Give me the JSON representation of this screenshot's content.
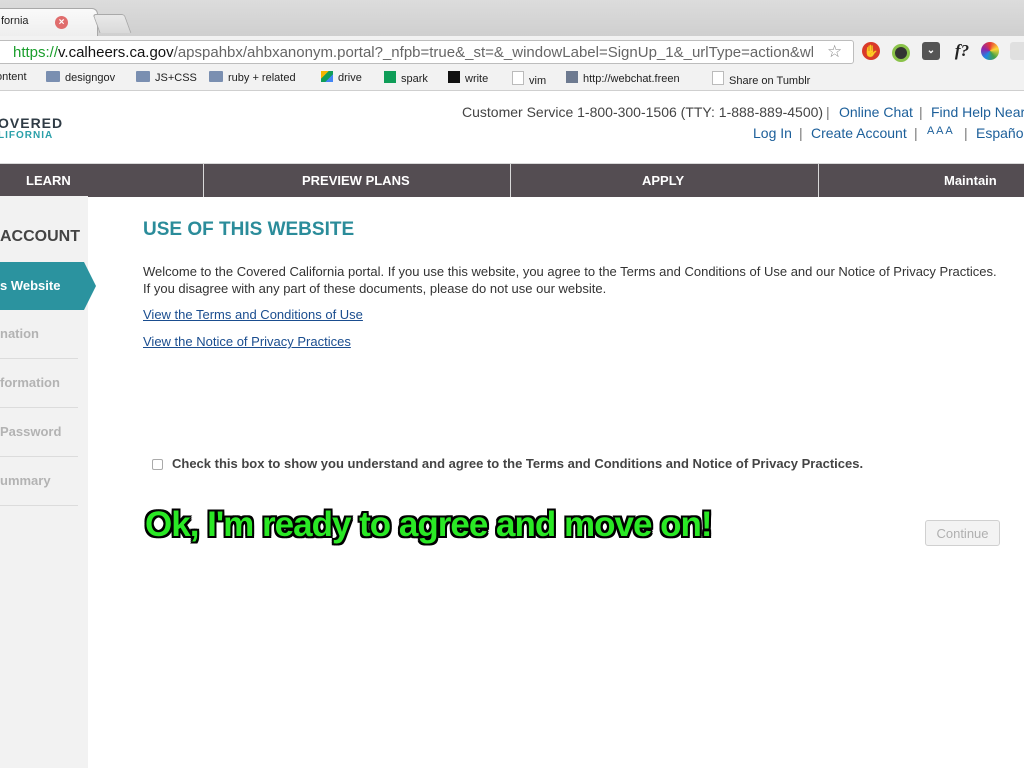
{
  "browser": {
    "tab_title": "fornia",
    "tab_close": "×",
    "url_scheme": "https://",
    "url_host": "v.calheers.ca.gov",
    "url_path": "/apspahbx/ahbxanonym.portal?_nfpb=true&_st=&_windowLabel=SignUp_1&_urlType=action&wl...",
    "star_icon": "☆",
    "extensions": [
      "hand-icon",
      "colorpicker-icon",
      "pocket-icon",
      "font-icon",
      "colorwheel-icon"
    ],
    "font_ext_label": "f?",
    "bookmarks": [
      {
        "label": "ontent",
        "icon": "folder-icon"
      },
      {
        "label": "designgov",
        "icon": "folder-icon"
      },
      {
        "label": "JS+CSS",
        "icon": "folder-icon"
      },
      {
        "label": "ruby + related",
        "icon": "folder-icon"
      },
      {
        "label": "drive",
        "icon": "drive-icon"
      },
      {
        "label": "spark",
        "icon": "sheet-icon"
      },
      {
        "label": "write",
        "icon": "medium-icon"
      },
      {
        "label": "vim",
        "icon": "page-icon"
      },
      {
        "label": "http://webchat.freen",
        "icon": "chat-icon"
      },
      {
        "label": "Share on Tumblr",
        "icon": "page-icon"
      }
    ]
  },
  "header": {
    "logo_line1": "OVERED",
    "logo_line2": "LIFORNIA",
    "customer_service": "Customer Service 1-800-300-1506 (TTY: 1-888-889-4500)",
    "online_chat": "Online Chat",
    "find_help": "Find Help Near",
    "login": "Log In",
    "create_account": "Create Account",
    "text_size": "A A A",
    "espanol": "Español",
    "separator": "|"
  },
  "nav": {
    "items": [
      "LEARN",
      "PREVIEW PLANS",
      "APPLY",
      "Maintain"
    ]
  },
  "sidebar": {
    "title": "ACCOUNT",
    "active": "s Website",
    "items": [
      "nation",
      "formation",
      "Password",
      "ummary"
    ]
  },
  "main": {
    "heading": "USE OF THIS WEBSITE",
    "paragraph": "Welcome to the Covered California portal. If you use this website, you agree to the Terms and Conditions of Use and our Notice of Privacy Practices. If you disagree with any part of these documents, please do not use our website.",
    "link_terms": "View the Terms and Conditions of Use",
    "link_privacy": "View the Notice of Privacy Practices",
    "checkbox_label": "Check this box to show you understand and agree to the Terms and Conditions and Notice of Privacy Practices.",
    "overlay_caption": "Ok, I'm ready to agree and move on!",
    "continue_label": "Continue"
  },
  "colors": {
    "nav_bg": "#544d52",
    "accent_teal": "#2b939f",
    "link_blue": "#1a4d8f",
    "overlay_green": "#2ae825"
  }
}
